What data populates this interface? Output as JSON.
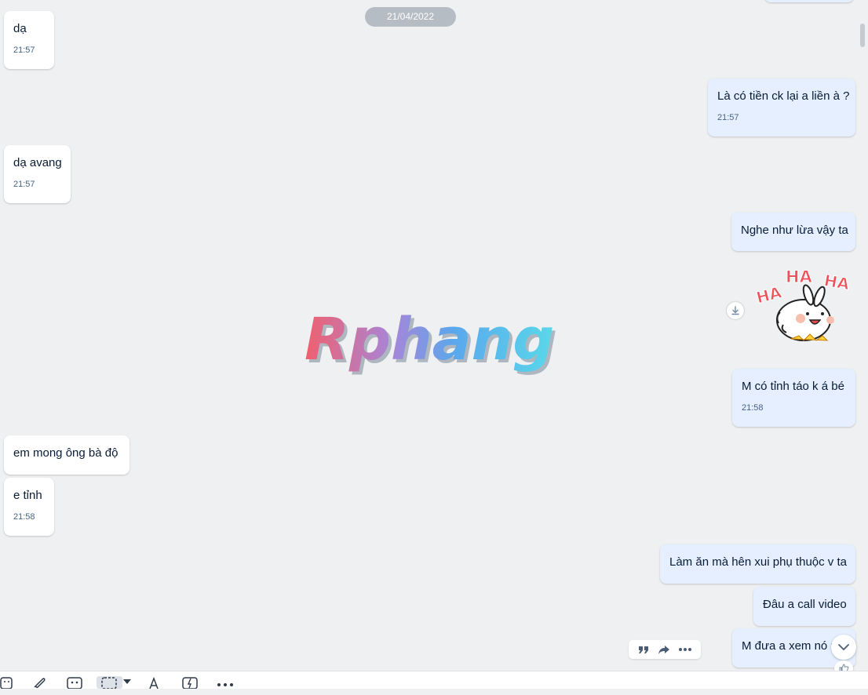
{
  "date_divider": "21/04/2022",
  "watermark": "Rphang",
  "messages": [
    {
      "text": "dạ",
      "time": "21:57",
      "side": "in"
    },
    {
      "text": "Là có tiền ck lại a liền à ?",
      "time": "21:57",
      "side": "out"
    },
    {
      "text": "dạ avang",
      "time": "21:57",
      "side": "in"
    },
    {
      "text": "Nghe như lừa vậy ta",
      "time": "",
      "side": "out"
    },
    {
      "sticker": "haha-bunny",
      "sticker_text": [
        "HA",
        "HA",
        "HA"
      ],
      "side": "out"
    },
    {
      "text": "M có tỉnh táo k á bé",
      "time": "21:58",
      "side": "out"
    },
    {
      "text": "em mong ông bà độ",
      "time": "",
      "side": "in"
    },
    {
      "text": "e tỉnh",
      "time": "21:58",
      "side": "in"
    },
    {
      "text": "Làm ăn mà hên xui phụ thuộc v ta",
      "time": "",
      "side": "out"
    },
    {
      "text": "Đâu a call video",
      "time": "",
      "side": "out"
    },
    {
      "text": "M đưa a xem nó r",
      "time": "",
      "side": "out"
    }
  ],
  "message_actions": [
    "quote-icon",
    "share-icon",
    "more-icon"
  ],
  "toolbar": [
    "sticker-icon",
    "image-icon",
    "attach-icon",
    "contact-card-icon",
    "screenshot-icon",
    "dropdown-arrow-icon",
    "text-format-icon",
    "quick-message-icon",
    "more-icon"
  ],
  "colors": {
    "outgoing_bubble": "#e5efff",
    "incoming_bubble": "#ffffff",
    "background": "#eef0f1",
    "time_text": "#476285"
  }
}
